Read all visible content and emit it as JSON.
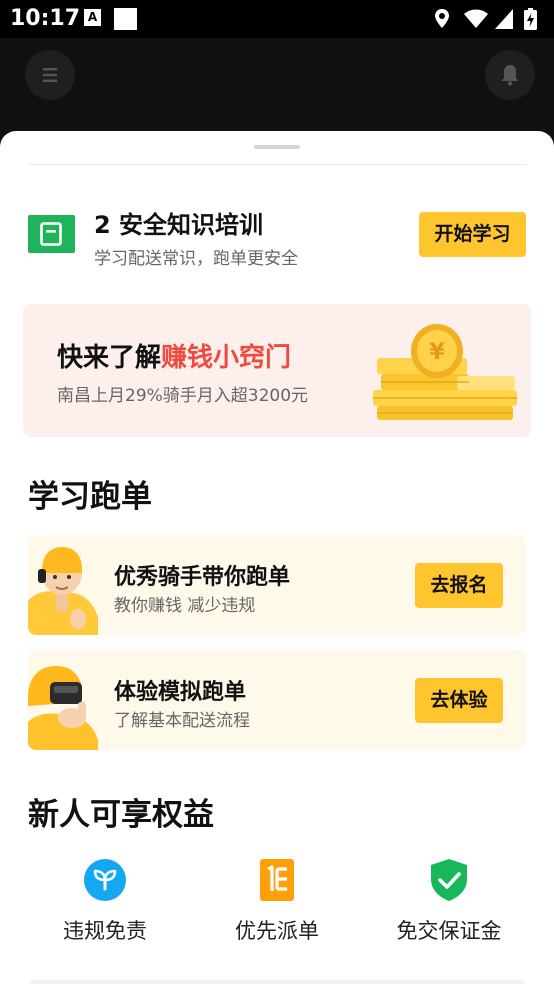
{
  "status_bar": {
    "time": "10:17",
    "keyboard_badge": "A",
    "icons": [
      "location-icon",
      "wifi-icon",
      "signal-icon",
      "battery-charging-icon"
    ]
  },
  "header": {
    "menu_icon": "menu-icon",
    "bell_icon": "bell-icon"
  },
  "training": {
    "title": "2 安全知识培训",
    "subtitle": "学习配送常识，跑单更安全",
    "button": "开始学习",
    "icon": "book-icon",
    "icon_color": "#1fb35a"
  },
  "banner": {
    "title_prefix": "快来了解",
    "title_highlight": "赚钱小窍门",
    "subtitle": "南昌上月29%骑手月入超3200元",
    "highlight_color": "#f04a3e",
    "image": "gold-coins-illustration"
  },
  "learn_section": {
    "title": "学习跑单",
    "cards": [
      {
        "title": "优秀骑手带你跑单",
        "subtitle": "教你赚钱 减少违规",
        "button": "去报名",
        "image": "rider-avatar"
      },
      {
        "title": "体验模拟跑单",
        "subtitle": "了解基本配送流程",
        "button": "去体验",
        "image": "vr-helmet-avatar"
      }
    ]
  },
  "benefits_section": {
    "title": "新人可享权益",
    "items": [
      {
        "label": "违规免责",
        "icon": "sprout-icon",
        "color": "#14a8f0"
      },
      {
        "label": "优先派单",
        "icon": "priority-order-icon",
        "color": "#ff9f0a"
      },
      {
        "label": "免交保证金",
        "icon": "shield-check-icon",
        "color": "#16b85a"
      }
    ]
  },
  "colors": {
    "accent": "#ffc52e",
    "banner_bg": "#fdf0ec",
    "card_bg": "#fff9ea"
  }
}
